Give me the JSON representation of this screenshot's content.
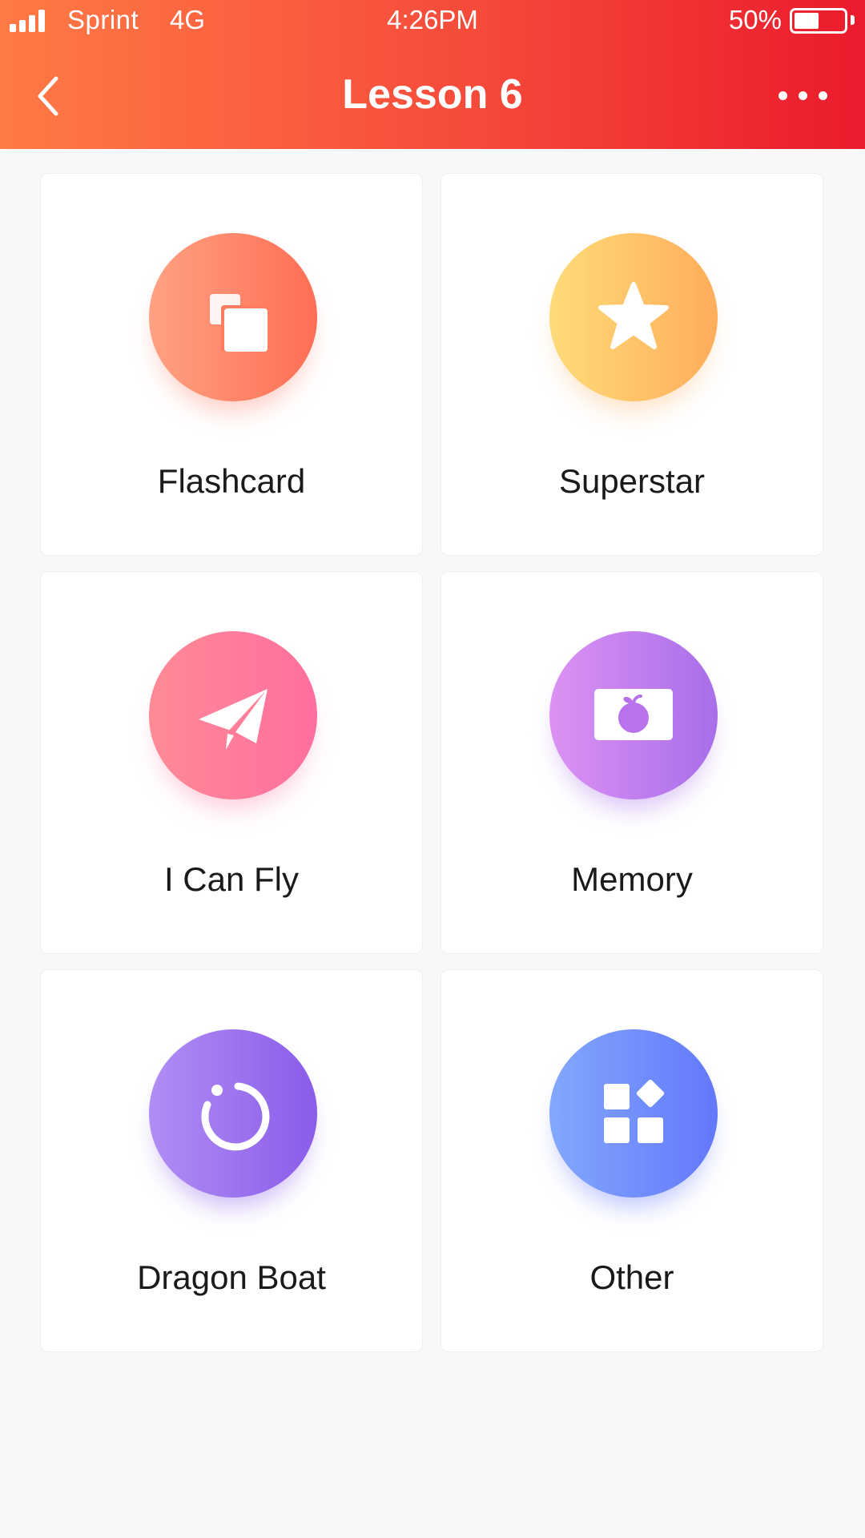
{
  "status_bar": {
    "carrier": "Sprint",
    "network": "4G",
    "time": "4:26PM",
    "battery_percent": "50%",
    "battery_level": 0.5
  },
  "header": {
    "title": "Lesson 6",
    "back_icon": "chevron-left-icon",
    "more_icon": "more-horizontal-icon",
    "colors": {
      "gradient_start": "#ff7a45",
      "gradient_end": "#ea1b2d"
    }
  },
  "activities": [
    {
      "label": "Flashcard",
      "icon": "cards-icon",
      "color_start": "#ffa283",
      "color_end": "#ff6e54"
    },
    {
      "label": "Superstar",
      "icon": "star-icon",
      "color_start": "#ffdb79",
      "color_end": "#ffad5a"
    },
    {
      "label": "I Can Fly",
      "icon": "paper-plane-icon",
      "color_start": "#ff8a96",
      "color_end": "#ff6f9f"
    },
    {
      "label": "Memory",
      "icon": "apple-card-icon",
      "color_start": "#dc92f3",
      "color_end": "#a86ee9"
    },
    {
      "label": "Dragon Boat",
      "icon": "circle-loop-icon",
      "color_start": "#b08ef5",
      "color_end": "#8a5ce9"
    },
    {
      "label": "Other",
      "icon": "grid-apps-icon",
      "color_start": "#82a8fd",
      "color_end": "#6378fb"
    }
  ]
}
